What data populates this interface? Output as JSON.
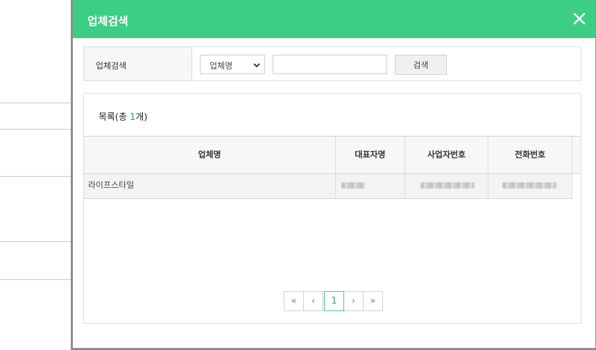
{
  "modal": {
    "title": "업체검색",
    "close_icon": "close-icon"
  },
  "search": {
    "label": "업체검색",
    "field_select": {
      "selected": "업체명"
    },
    "input": {
      "value": "",
      "placeholder": ""
    },
    "button_label": "검색"
  },
  "list": {
    "prefix": "목록(총 ",
    "count": "1",
    "suffix": "개)",
    "columns": [
      "업체명",
      "대표자명",
      "사업자번호",
      "전화번호"
    ],
    "rows": [
      {
        "name": "라이프스타일",
        "representative": "",
        "business_number": "",
        "phone": ""
      }
    ]
  },
  "pagination": {
    "first": "«",
    "prev": "‹",
    "current": "1",
    "next": "›",
    "last": "»"
  },
  "colors": {
    "header": "#3ccf84",
    "accent_text": "#2aa56b"
  }
}
